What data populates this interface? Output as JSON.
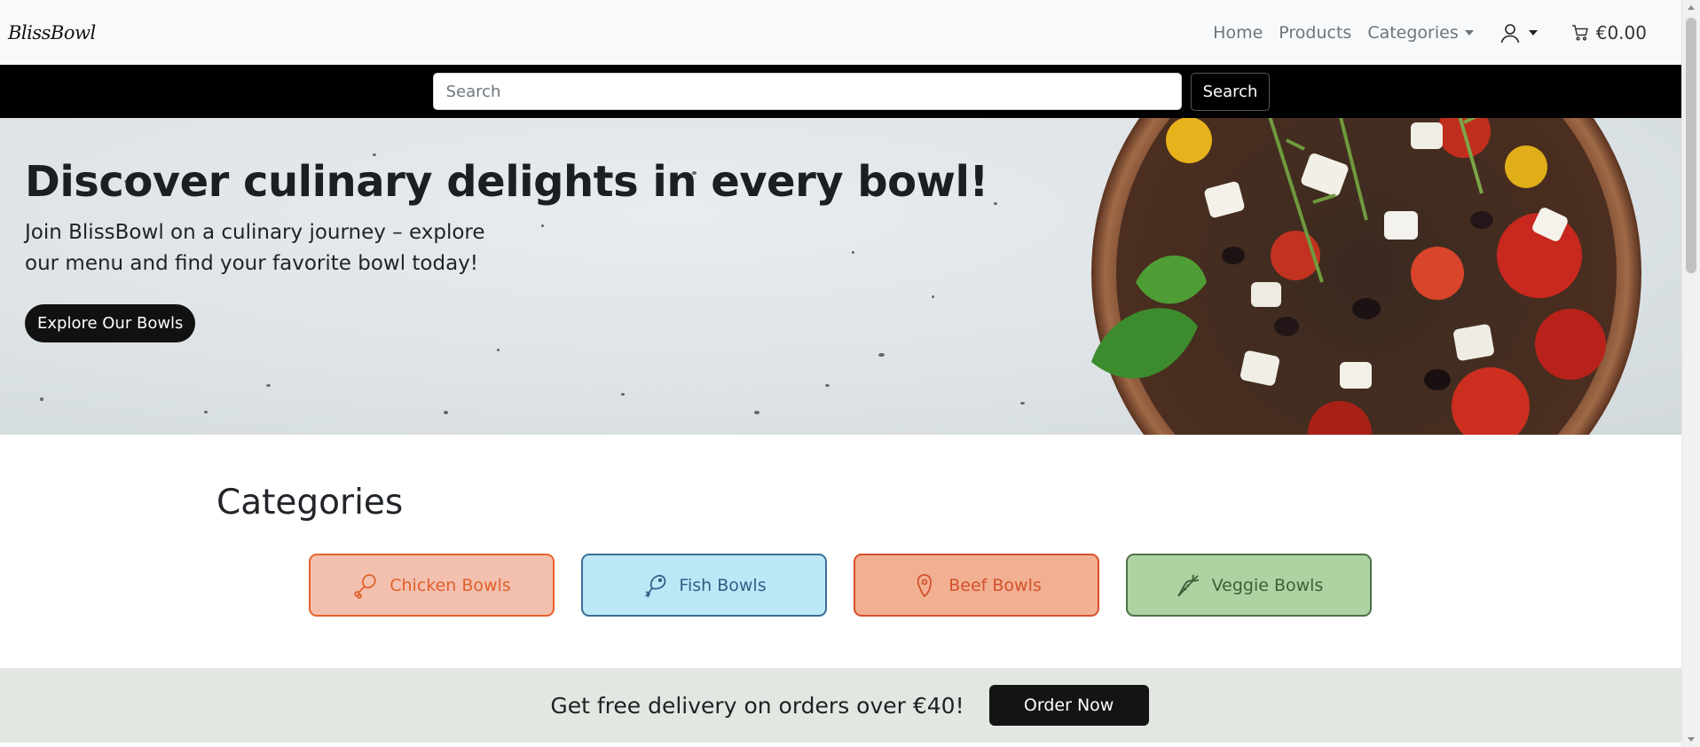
{
  "navbar": {
    "brand": "BlissBowl",
    "links": [
      "Home",
      "Products",
      "Categories"
    ],
    "cart_total": "€0.00"
  },
  "search": {
    "placeholder": "Search",
    "button_label": "Search"
  },
  "hero": {
    "title": "Discover culinary delights in every bowl!",
    "subtitle": "Join BlissBowl on a culinary journey – explore our menu and find your favorite bowl today!",
    "cta_label": "Explore Our Bowls"
  },
  "categories": {
    "heading": "Categories",
    "items": [
      {
        "label": "Chicken Bowls",
        "icon": "drumstick-icon",
        "color": "#e0602a",
        "bg": "#f3c0b0"
      },
      {
        "label": "Fish Bowls",
        "icon": "fish-icon",
        "color": "#2d5f86",
        "bg": "#bce7f6"
      },
      {
        "label": "Beef Bowls",
        "icon": "steak-icon",
        "color": "#d3512a",
        "bg": "#f2b093"
      },
      {
        "label": "Veggie Bowls",
        "icon": "carrot-icon",
        "color": "#3e5e3a",
        "bg": "#aed3a2"
      }
    ]
  },
  "promo": {
    "text": "Get free delivery on orders over €40!",
    "button_label": "Order Now"
  }
}
